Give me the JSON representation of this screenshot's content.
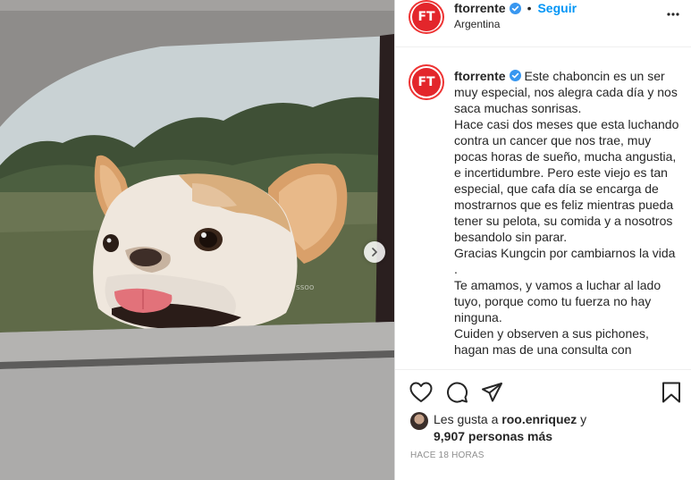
{
  "post": {
    "username": "ftorrente",
    "avatar_initials": "FT",
    "separator": "•",
    "follow_label": "Seguir",
    "location": "Argentina",
    "watermark": "ssoo",
    "caption_username": "ftorrente",
    "caption_text": " Este chaboncin es un ser muy especial, nos alegra cada día y nos saca muchas sonrisas.\nHace casi dos meses que esta luchando contra un cancer que nos trae, muy pocas horas de sueño, mucha angustia, e incertidumbre. Pero este viejo es tan especial, que cafa día se encarga de mostrarnos que es feliz mientras pueda tener su pelota, su comida y a nosotros besandolo sin parar.\nGracias Kungcin por cambiarnos la vida .\nTe amamos, y vamos a luchar al lado tuyo, porque como tu fuerza no hay ninguna.\nCuiden y observen a sus pichones, hagan mas de una consulta con",
    "likes_prefix": "Les gusta a ",
    "likes_user": "roo.enriquez",
    "likes_middle": " y",
    "likes_count": "9,907 personas más",
    "timestamp": "HACE 18 HORAS"
  },
  "icons": {
    "verified": "verified-badge-icon",
    "more": "more-options-icon",
    "like": "heart-icon",
    "comment": "comment-icon",
    "share": "send-icon",
    "save": "bookmark-icon",
    "next": "chevron-right-icon"
  },
  "colors": {
    "brand_red": "#e3262b",
    "link_blue": "#0095f6",
    "verified_blue": "#3897f0",
    "meta_gray": "#8e8e8e"
  }
}
